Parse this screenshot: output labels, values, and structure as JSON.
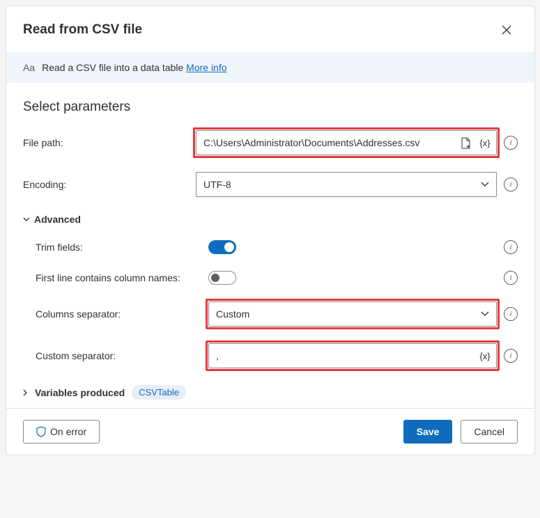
{
  "dialog": {
    "title": "Read from CSV file",
    "banner_text": "Read a CSV file into a data table ",
    "more_info": "More info"
  },
  "section_title": "Select parameters",
  "fields": {
    "file_path": {
      "label": "File path:",
      "value": "C:\\Users\\Administrator\\Documents\\Addresses.csv"
    },
    "encoding": {
      "label": "Encoding:",
      "value": "UTF-8"
    }
  },
  "advanced": {
    "label": "Advanced",
    "trim_fields": {
      "label": "Trim fields:",
      "on": true
    },
    "first_line": {
      "label": "First line contains column names:",
      "on": false
    },
    "separator": {
      "label": "Columns separator:",
      "value": "Custom"
    },
    "custom_separator": {
      "label": "Custom separator:",
      "value": ","
    }
  },
  "variables": {
    "label": "Variables produced",
    "badge": "CSVTable"
  },
  "footer": {
    "on_error": "On error",
    "save": "Save",
    "cancel": "Cancel"
  }
}
